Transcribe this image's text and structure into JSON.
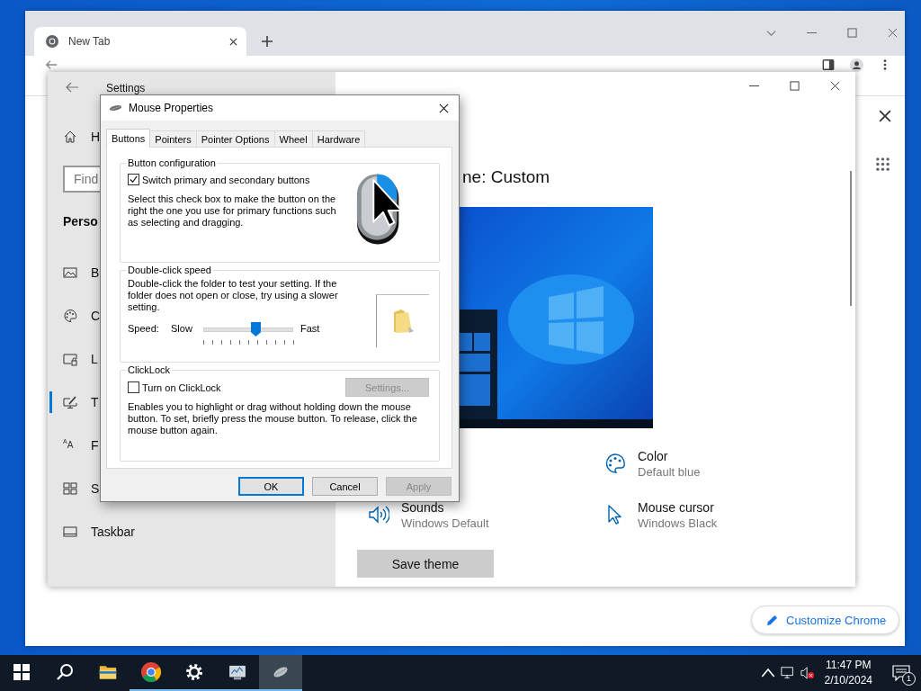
{
  "browser": {
    "tabs": [
      {
        "label": "New Tab",
        "selected": true
      }
    ],
    "customize_button": "Customize Chrome"
  },
  "settings": {
    "title": "Settings",
    "home_label": "H",
    "search": {
      "placeholder": "Find"
    },
    "section_heading": "Perso",
    "nav": [
      {
        "kind": "background",
        "label": "B",
        "selected": false
      },
      {
        "kind": "colors",
        "label": "C",
        "selected": false
      },
      {
        "kind": "lock",
        "label": "L",
        "selected": false
      },
      {
        "kind": "themes",
        "label": "T",
        "selected": true
      },
      {
        "kind": "fonts",
        "icon_text": "$^{A}$A",
        "label": "F",
        "selected": false
      },
      {
        "kind": "start",
        "label": "S",
        "selected": false
      },
      {
        "kind": "taskbar",
        "label": "Taskbar",
        "selected": false
      }
    ],
    "heading": "ne: Custom",
    "theme_options": [
      {
        "kind": "color",
        "title": "Color",
        "value": "Default blue"
      },
      {
        "kind": "sounds",
        "title": "Sounds",
        "value": "Windows Default"
      },
      {
        "kind": "cursor",
        "title": "Mouse cursor",
        "value": "Windows Black"
      }
    ],
    "save_button": "Save theme"
  },
  "dialog": {
    "title": "Mouse Properties",
    "tabs": [
      {
        "label": "Buttons",
        "selected": true
      },
      {
        "label": "Pointers",
        "selected": false
      },
      {
        "label": "Pointer Options",
        "selected": false
      },
      {
        "label": "Wheel",
        "selected": false
      },
      {
        "label": "Hardware",
        "selected": false
      }
    ],
    "button_configuration": {
      "title": "Button configuration",
      "checkbox": {
        "label": "Switch primary and secondary buttons",
        "checked": true
      },
      "description": "Select this check box to make the button on the right the one you use for primary functions such as selecting and dragging."
    },
    "double_click_speed": {
      "title": "Double-click speed",
      "description": "Double-click the folder to test your setting. If the folder does not open or close, try using a slower setting.",
      "speed_label": "Speed:",
      "slow_label": "Slow",
      "fast_label": "Fast",
      "level": 0.58
    },
    "clicklock": {
      "title": "ClickLock",
      "checkbox": {
        "label": "Turn on ClickLock",
        "checked": false
      },
      "settings_button": {
        "label": "Settings...",
        "disabled": true
      },
      "description": "Enables you to highlight or drag without holding down the mouse button. To set, briefly press the mouse button. To release, click the mouse button again."
    },
    "buttons": [
      {
        "label": "OK",
        "default": true,
        "disabled": false
      },
      {
        "label": "Cancel",
        "default": false,
        "disabled": false
      },
      {
        "label": "Apply",
        "default": false,
        "disabled": true
      }
    ]
  },
  "taskbar": {
    "apps": [
      {
        "kind": "start",
        "running": false,
        "selected": false
      },
      {
        "kind": "search",
        "running": false,
        "selected": false
      },
      {
        "kind": "explorer",
        "running": false,
        "selected": false
      },
      {
        "kind": "chrome",
        "running": true,
        "selected": false
      },
      {
        "kind": "settings",
        "running": true,
        "selected": false
      },
      {
        "kind": "monitor",
        "running": true,
        "selected": false
      },
      {
        "kind": "mouse",
        "running": true,
        "selected": true
      }
    ],
    "time": "11:47 PM",
    "date": "2/10/2024",
    "notification_count": "1"
  }
}
